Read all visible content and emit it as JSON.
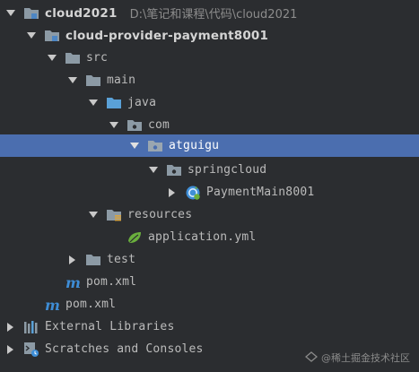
{
  "tree": {
    "root": {
      "label": "cloud2021",
      "path": "D:\\笔记和课程\\代码\\cloud2021"
    },
    "module": {
      "label": "cloud-provider-payment8001"
    },
    "src": {
      "label": "src"
    },
    "main": {
      "label": "main"
    },
    "java": {
      "label": "java"
    },
    "com": {
      "label": "com"
    },
    "atguigu": {
      "label": "atguigu"
    },
    "springcloud": {
      "label": "springcloud"
    },
    "payment_main": {
      "label": "PaymentMain8001"
    },
    "resources": {
      "label": "resources"
    },
    "application_yml": {
      "label": "application.yml"
    },
    "test": {
      "label": "test"
    },
    "module_pom": {
      "label": "pom.xml"
    },
    "root_pom": {
      "label": "pom.xml"
    },
    "external_libraries": {
      "label": "External Libraries"
    },
    "scratches": {
      "label": "Scratches and Consoles"
    }
  },
  "watermark": {
    "text": "@稀土掘金技术社区"
  },
  "colors": {
    "background": "#2b2d30",
    "selection": "#4b6eaf",
    "folder": "#8c9aa5",
    "source_folder": "#5aa1d8",
    "maven": "#3e8dd6"
  }
}
